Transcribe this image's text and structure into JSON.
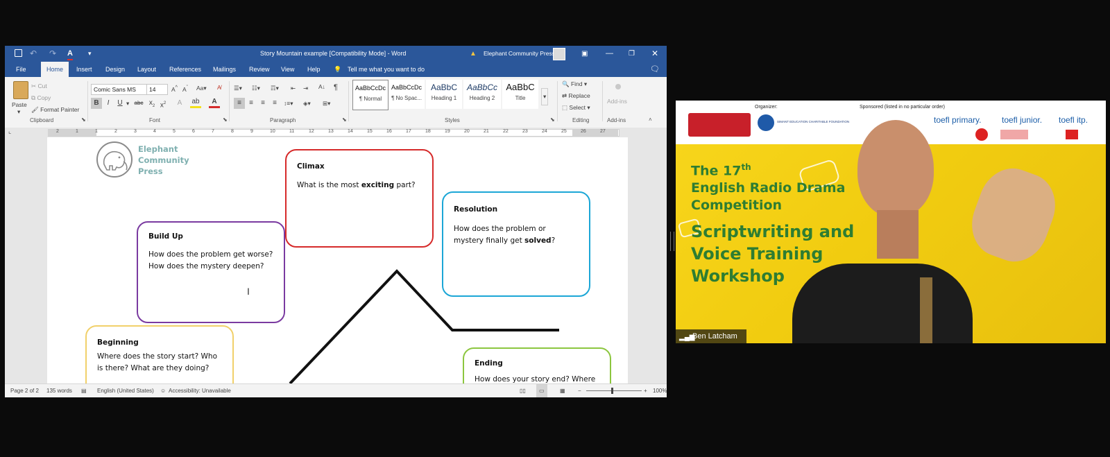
{
  "word": {
    "title": "Story Mountain example [Compatibility Mode] - Word",
    "user": "Elephant Community Press",
    "tabs": [
      "File",
      "Home",
      "Insert",
      "Design",
      "Layout",
      "References",
      "Mailings",
      "Review",
      "View",
      "Help"
    ],
    "tell_me": "Tell me what you want to do",
    "clipboard": {
      "paste": "Paste",
      "cut": "Cut",
      "copy": "Copy",
      "format_painter": "Format Painter",
      "group": "Clipboard"
    },
    "font": {
      "name": "Comic Sans MS",
      "size": "14",
      "group": "Font"
    },
    "paragraph_group": "Paragraph",
    "styles": [
      {
        "sample": "AaBbCcDc",
        "name": "¶ Normal"
      },
      {
        "sample": "AaBbCcDc",
        "name": "¶ No Spac..."
      },
      {
        "sample": "AaBbC",
        "name": "Heading 1"
      },
      {
        "sample": "AaBbCc",
        "name": "Heading 2"
      },
      {
        "sample": "AaBbC",
        "name": "Title"
      }
    ],
    "styles_group": "Styles",
    "editing": {
      "find": "Find",
      "replace": "Replace",
      "select": "Select",
      "group": "Editing"
    },
    "addins": {
      "label": "Add-ins",
      "group": "Add-ins"
    },
    "ruler_numbers": [
      "2",
      "1",
      "1",
      "2",
      "3",
      "4",
      "5",
      "6",
      "7",
      "8",
      "9",
      "10",
      "11",
      "12",
      "13",
      "14",
      "15",
      "16",
      "17",
      "18",
      "19",
      "20",
      "21",
      "22",
      "23",
      "24",
      "25",
      "26",
      "27"
    ],
    "document": {
      "logo": [
        "Elephant",
        "Community",
        "Press"
      ],
      "climax": {
        "heading": "Climax",
        "pre": "What is the most ",
        "bold": "exciting",
        "post": " part?"
      },
      "resolution": {
        "heading": "Resolution",
        "line1": "How does the problem or",
        "pre": "mystery finally get ",
        "bold": "solved",
        "post": "?"
      },
      "build_up": {
        "heading": "Build Up",
        "line1": "How does the problem get worse?",
        "line2": "How does the mystery deepen?"
      },
      "beginning": {
        "heading": "Beginning",
        "line1": "Where does the story start? Who",
        "line2": "is there? What are they doing?"
      },
      "ending": {
        "heading": "Ending",
        "line1": "How does your story end? Where"
      }
    },
    "status": {
      "page": "Page 2 of 2",
      "words": "135 words",
      "language": "English (United States)",
      "accessibility": "Accessibility: Unavailable",
      "zoom": "100%"
    }
  },
  "video": {
    "organizer_label": "Organizer:",
    "sponsor_label": "Sponsored (listed in no particular order)",
    "foundation": "SIMANT EDUCATION CHARITABLE FOUNDATION",
    "sponsors": [
      "toefl primary.",
      "toefl junior.",
      "toefl itp."
    ],
    "title_line1": "The 17",
    "title_sup": "th",
    "title_line2": "English Radio Drama",
    "title_line3": "Competition",
    "workshop": [
      "Scriptwriting and",
      "Voice Training",
      "Workshop"
    ],
    "participant": "Ben Latcham"
  }
}
